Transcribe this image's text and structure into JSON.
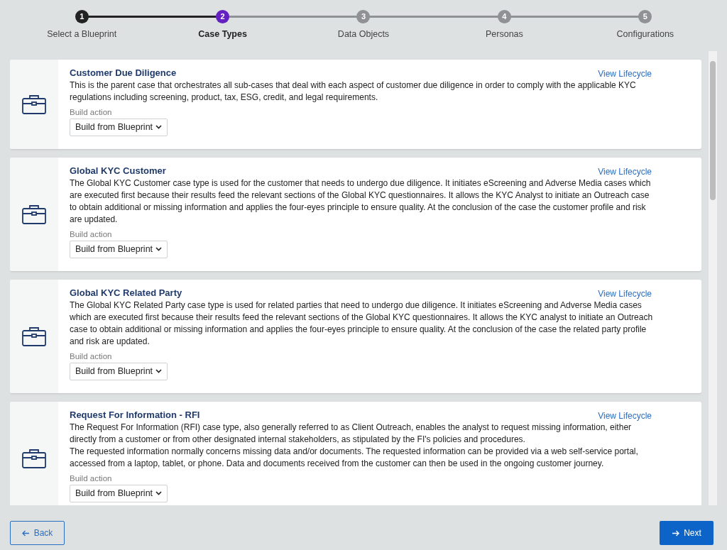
{
  "steps": [
    {
      "number": "1",
      "label": "Select a Blueprint",
      "completed": true,
      "selected": false
    },
    {
      "number": "2",
      "label": "Case Types",
      "completed": false,
      "selected": true
    },
    {
      "number": "3",
      "label": "Data Objects",
      "completed": false,
      "selected": false
    },
    {
      "number": "4",
      "label": "Personas",
      "completed": false,
      "selected": false
    },
    {
      "number": "5",
      "label": "Configurations",
      "completed": false,
      "selected": false
    }
  ],
  "case_types": [
    {
      "title": "Customer Due Diligence",
      "link": "View Lifecycle",
      "paragraphs": [
        "This is the parent case that orchestrates all sub-cases that deal with each aspect of customer due diligence in order to comply with the applicable KYC regulations including screening, product, tax, ESG, credit, and legal requirements."
      ],
      "field_label": "Build action",
      "value": "Build from Blueprint"
    },
    {
      "title": "Global KYC Customer",
      "link": "View Lifecycle",
      "paragraphs": [
        "The Global KYC Customer case type is used for the customer that needs to undergo due diligence. It initiates eScreening and Adverse Media cases which are executed first because their results feed the relevant sections of the Global KYC questionnaires. It allows the KYC Analyst to initiate an Outreach case to obtain additional or missing information and applies the four-eyes principle to ensure quality. At the conclusion of the case the customer profile and risk are updated."
      ],
      "field_label": "Build action",
      "value": "Build from Blueprint"
    },
    {
      "title": "Global KYC Related Party",
      "link": "View Lifecycle",
      "paragraphs": [
        "The Global KYC Related Party case type is used for related parties that need to undergo due diligence. It initiates eScreening and Adverse Media cases which are executed first because their results feed the relevant sections of the Global KYC questionnaires. It allows the KYC analyst to initiate an Outreach case to obtain additional or missing information and applies the four-eyes principle to ensure quality. At the conclusion of the case the related party profile and risk are updated."
      ],
      "field_label": "Build action",
      "value": "Build from Blueprint"
    },
    {
      "title": "Request For Information - RFI",
      "link": "View Lifecycle",
      "paragraphs": [
        "The Request For Information (RFI) case type, also generally referred to as Client Outreach, enables the analyst to request missing information, either directly from a customer or from other designated internal stakeholders, as stipulated by the FI's policies and procedures.",
        "The requested information normally concerns missing data and/or documents. The requested information can be provided via a web self-service portal, accessed from a laptop, tablet, or phone. Data and documents received from the customer can then be used in the ongoing customer journey."
      ],
      "field_label": "Build action",
      "value": "Build from Blueprint"
    }
  ],
  "back_button": "Back",
  "next_button": "Next"
}
